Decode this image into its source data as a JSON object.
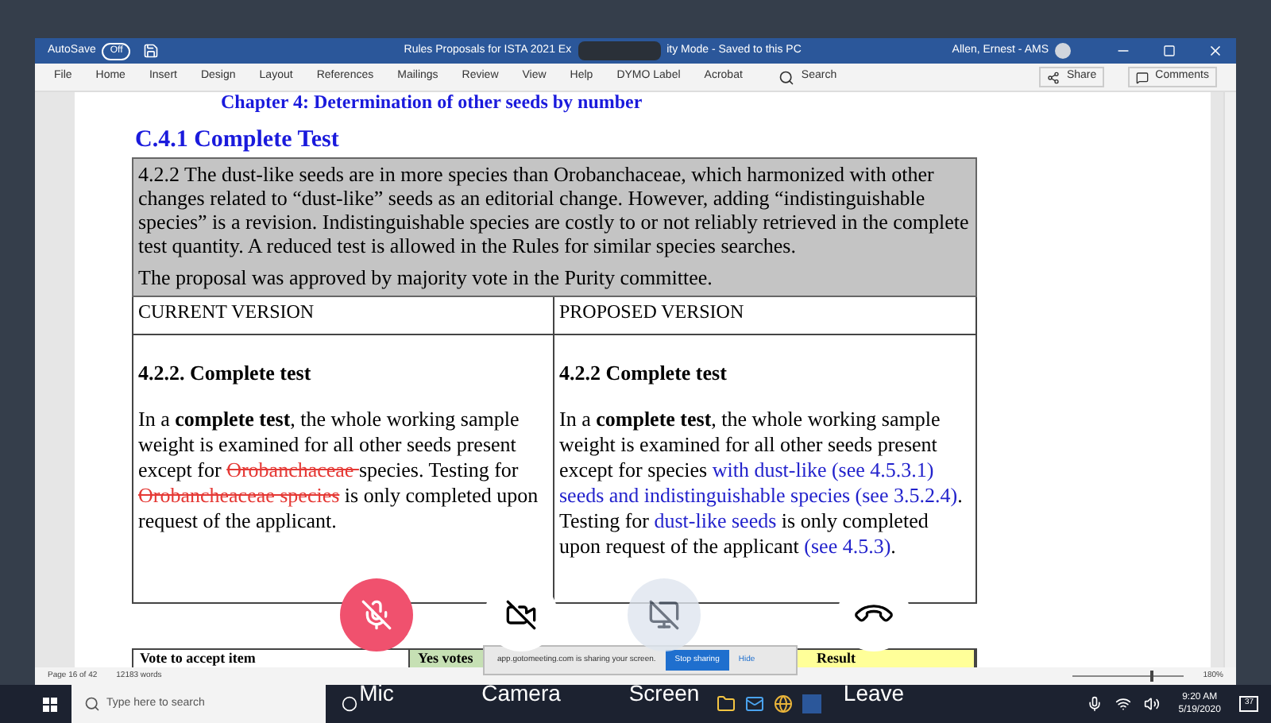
{
  "word": {
    "autosave_label": "AutoSave",
    "autosave_state": "Off",
    "autosave_on": false,
    "title_start": "Rules Proposals for ISTA 2021 Ex",
    "title_end": "ity Mode  -  Saved to this PC",
    "user": "Allen, Ernest - AMS",
    "ribbon_tabs": [
      "File",
      "Home",
      "Insert",
      "Design",
      "Layout",
      "References",
      "Mailings",
      "Review",
      "View",
      "Help",
      "DYMO Label",
      "Acrobat"
    ],
    "search": "Search",
    "share": "Share",
    "comments": "Comments"
  },
  "document": {
    "chapter": "Chapter 4: Determination of other seeds by number",
    "section": "C.4.1 Complete Test",
    "note": [
      "4.2.2  The dust-like seeds are in more species than Orobanchaceae, which harmonized with other changes related to “dust-like” seeds as an editorial change.  However, adding “indistinguishable species” is a revision. Indistinguishable species are costly to or not reliably retrieved in the complete test quantity.  A reduced test is allowed in the Rules for similar species searches.",
      "The proposal was approved by majority vote in the Purity committee."
    ],
    "columns": [
      {
        "header": "CURRENT VERSION",
        "heading": "4.2.2.  Complete test",
        "runs": [
          {
            "kind": "plain",
            "text": "In a "
          },
          {
            "kind": "bold",
            "text": "complete test"
          },
          {
            "kind": "plain",
            "text": ", the whole working sample weight is examined for all other seeds present except for "
          },
          {
            "kind": "deleted",
            "text": "Orobanchaceae "
          },
          {
            "kind": "plain",
            "text": "species. Testing for "
          },
          {
            "kind": "deleted",
            "text": "Orobancheaceae species"
          },
          {
            "kind": "plain",
            "text": " is only completed upon request of the applicant."
          }
        ]
      },
      {
        "header": "PROPOSED VERSION",
        "heading": "4.2.2  Complete test",
        "runs": [
          {
            "kind": "plain",
            "text": "In a "
          },
          {
            "kind": "bold",
            "text": "complete test"
          },
          {
            "kind": "plain",
            "text": ", the whole working sample weight is examined for all other seeds present except for species "
          },
          {
            "kind": "inserted",
            "text": "with dust-like (see 4.5.3.1) seeds and indistinguishable species (see 3.5.2.4)"
          },
          {
            "kind": "plain",
            "text": ". Testing for "
          },
          {
            "kind": "inserted",
            "text": "dust-like seeds"
          },
          {
            "kind": "plain",
            "text": " is only completed upon request of the applicant "
          },
          {
            "kind": "inserted",
            "text": "(see 4.5.3)"
          },
          {
            "kind": "plain",
            "text": "."
          }
        ]
      }
    ],
    "vote_row": [
      {
        "text": "Vote to accept item",
        "color": "#ffffff"
      },
      {
        "text": "Yes votes",
        "color": "#c6e0b4"
      },
      {
        "text": "Result",
        "color": "#ffff99"
      }
    ]
  },
  "status_bar": {
    "page": "Page 16 of 42",
    "words": "12183 words",
    "zoom": "180%",
    "zoom_slider": {
      "level": 0.7
    }
  },
  "sharing": {
    "message": "app.gotomeeting.com is sharing your screen.",
    "stop": "Stop sharing",
    "hide": "Hide"
  },
  "meeting_controls": [
    {
      "kind": "mic",
      "label": "Mic",
      "disabled": false
    },
    {
      "kind": "camera",
      "label": "Camera",
      "disabled": false
    },
    {
      "kind": "screen",
      "label": "Screen",
      "disabled": true
    },
    {
      "kind": "leave",
      "label": "Leave",
      "disabled": false
    }
  ],
  "taskbar": {
    "search_placeholder": "Type here to search",
    "time": "9:20 AM",
    "date": "5/19/2020",
    "notifications": "37"
  }
}
